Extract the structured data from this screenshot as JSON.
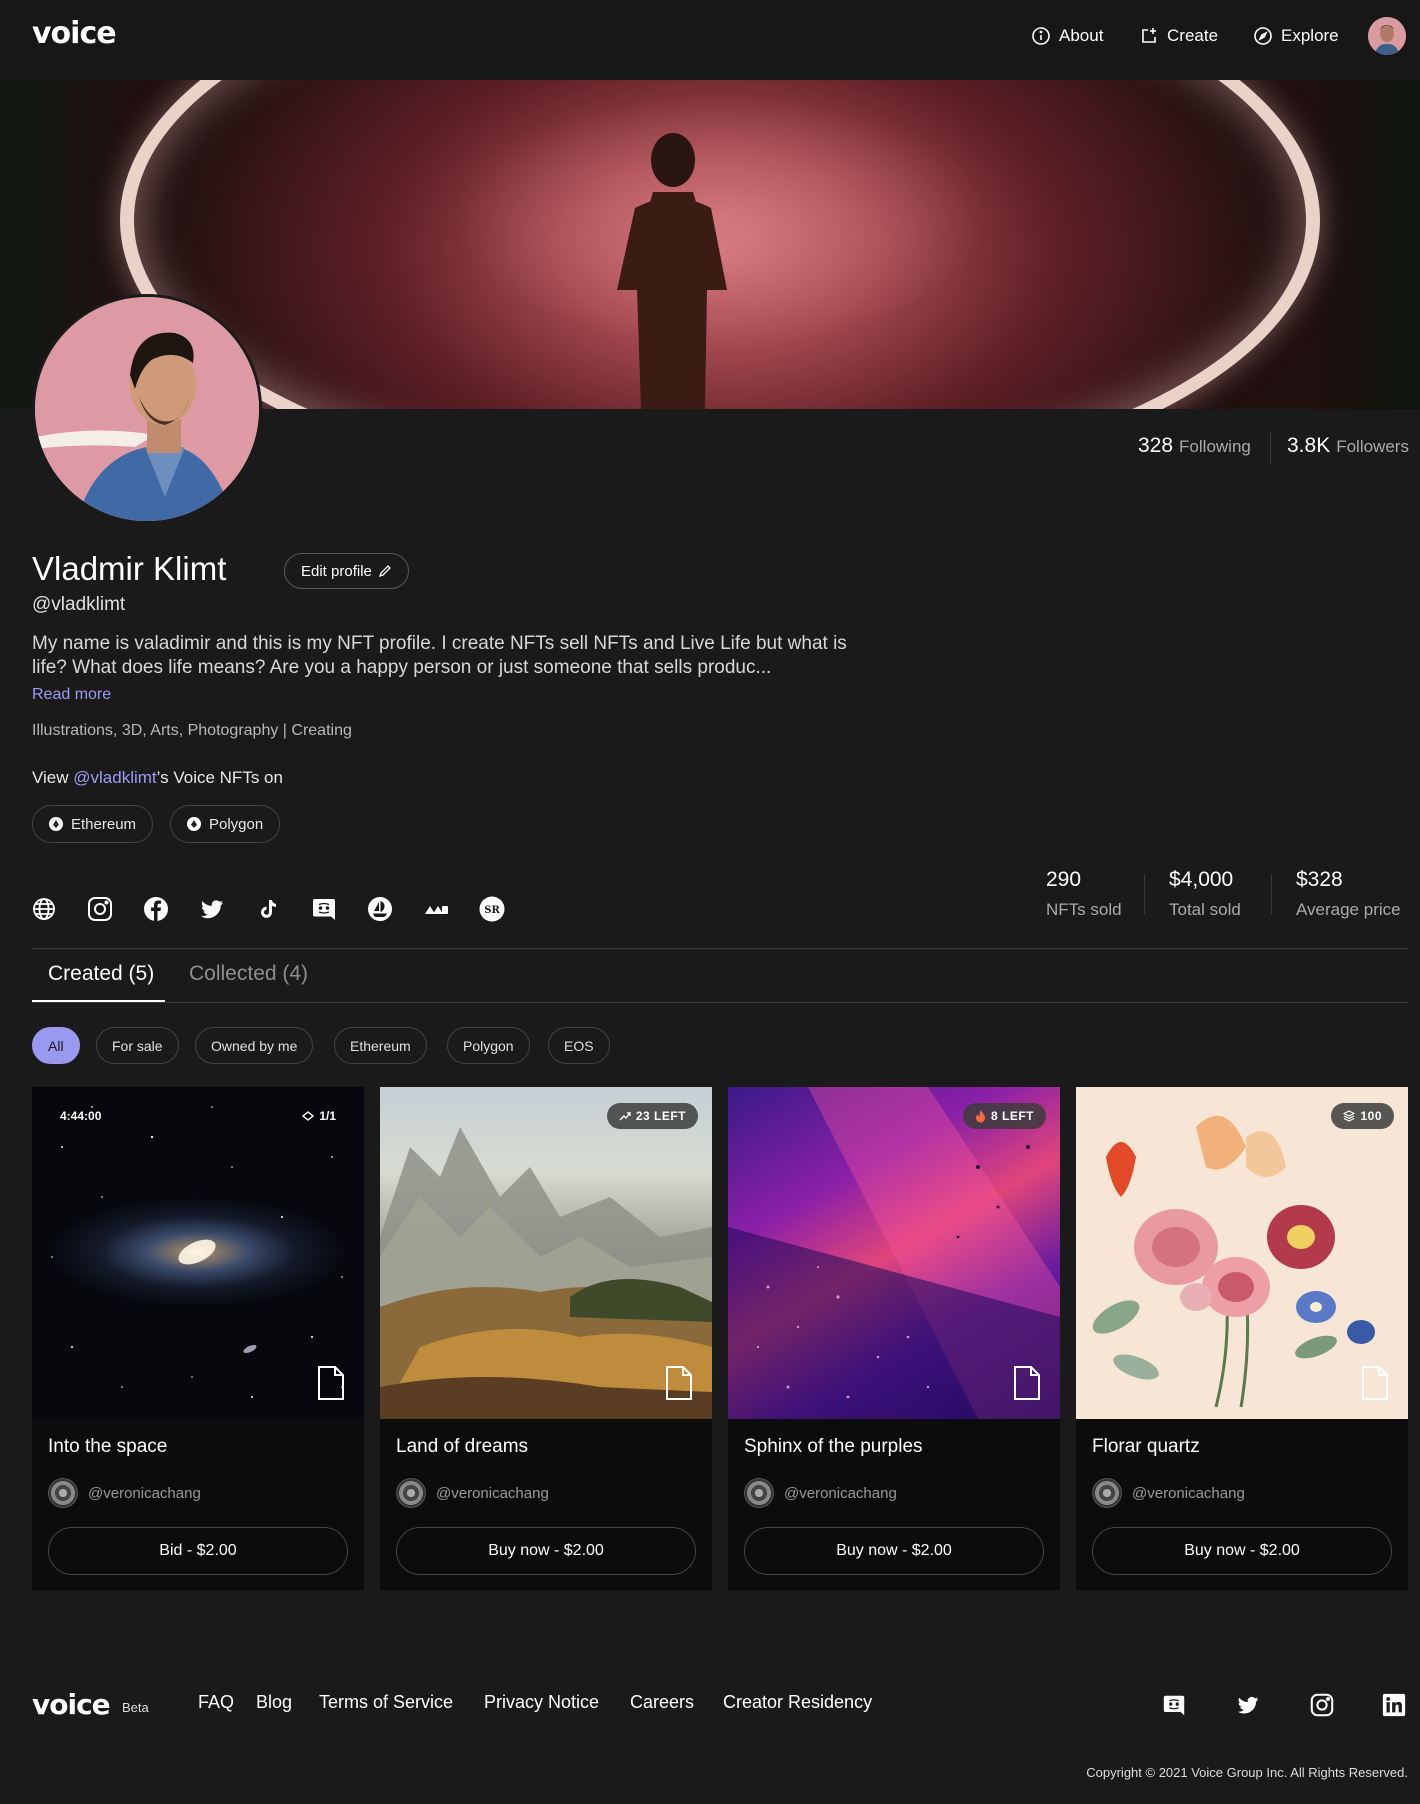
{
  "header": {
    "logo": "voice",
    "nav": [
      {
        "label": "About",
        "icon": "info-icon"
      },
      {
        "label": "Create",
        "icon": "create-icon"
      },
      {
        "label": "Explore",
        "icon": "compass-icon"
      }
    ]
  },
  "profile": {
    "name": "Vladmir Klimt",
    "handle": "@vladklimt",
    "edit_label": "Edit profile",
    "bio": "My name is valadimir and this is my NFT profile. I create NFTs sell NFTs and Live Life but what is life? What does life means? Are you a happy person or just someone that sells produc...",
    "read_more": "Read more",
    "tags": "Illustrations, 3D, Arts, Photography | Creating",
    "view_prefix": "View ",
    "view_handle": "@vladklimt",
    "view_suffix": "’s Voice NFTs on",
    "chains": [
      "Ethereum",
      "Polygon"
    ],
    "following_count": "328",
    "following_label": "Following",
    "followers_count": "3.8K",
    "followers_label": "Followers"
  },
  "socials": [
    "globe-icon",
    "instagram-icon",
    "facebook-icon",
    "twitter-icon",
    "tiktok-icon",
    "discord-icon",
    "opensea-icon",
    "rarible-icon",
    "superrare-icon"
  ],
  "sales": {
    "nfts_sold_value": "290",
    "nfts_sold_label": "NFTs sold",
    "total_sold_value": "$4,000",
    "total_sold_label": "Total sold",
    "avg_price_value": "$328",
    "avg_price_label": "Average price"
  },
  "tabs": {
    "created": "Created (5)",
    "collected": "Collected (4)"
  },
  "filters": [
    "All",
    "For sale",
    "Owned by me",
    "Ethereum",
    "Polygon",
    "EOS"
  ],
  "cards": [
    {
      "title": "Into the space",
      "creator": "@veronicachang",
      "cta": "Bid - $2.00",
      "timer": "4:44:00",
      "edition": "1/1"
    },
    {
      "title": "Land of dreams",
      "creator": "@veronicachang",
      "cta": "Buy now - $2.00",
      "badge": "23 LEFT"
    },
    {
      "title": "Sphinx of the purples",
      "creator": "@veronicachang",
      "cta": "Buy now - $2.00",
      "badge": "8 LEFT"
    },
    {
      "title": "Florar quartz",
      "creator": "@veronicachang",
      "cta": "Buy now - $2.00",
      "badge": "100"
    }
  ],
  "footer": {
    "logo": "voice",
    "beta": "Beta",
    "links": [
      "FAQ",
      "Blog",
      "Terms of Service",
      "Privacy Notice",
      "Careers",
      "Creator Residency"
    ],
    "socials": [
      "discord-icon",
      "twitter-icon",
      "instagram-icon",
      "linkedin-icon"
    ],
    "copyright": "Copyright © 2021 Voice Group Inc. All Rights Reserved."
  },
  "colors": {
    "accent": "#9999f0",
    "background": "#1a1a1a",
    "card": "#0c0c0c"
  }
}
